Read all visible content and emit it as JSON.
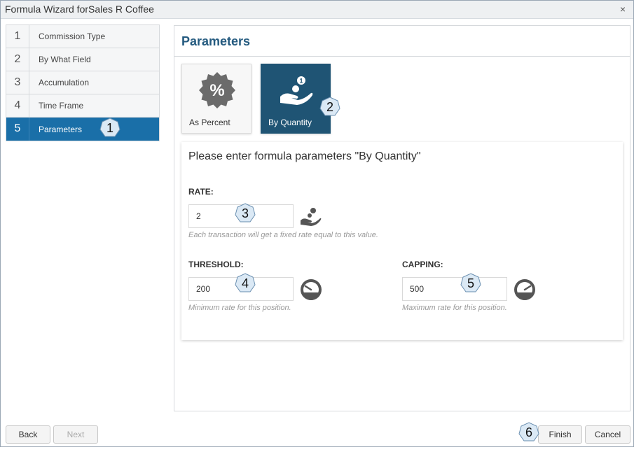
{
  "window": {
    "title": "Formula Wizard forSales R Coffee",
    "close_label": "×"
  },
  "steps": [
    {
      "num": "1",
      "label": "Commission Type"
    },
    {
      "num": "2",
      "label": "By What Field"
    },
    {
      "num": "3",
      "label": "Accumulation"
    },
    {
      "num": "4",
      "label": "Time Frame"
    },
    {
      "num": "5",
      "label": "Parameters"
    }
  ],
  "panel": {
    "title": "Parameters",
    "tiles": [
      {
        "label": "As Percent",
        "icon": "percent-badge-icon",
        "selected": false
      },
      {
        "label": "By Quantity",
        "icon": "hand-coins-icon",
        "selected": true
      }
    ]
  },
  "form": {
    "title": "Please enter formula parameters \"By Quantity\"",
    "rate": {
      "label": "RATE:",
      "value": "2",
      "hint": "Each transaction will get a fixed rate equal to this value."
    },
    "threshold": {
      "label": "THRESHOLD:",
      "value": "200",
      "hint": "Minimum rate for this position."
    },
    "capping": {
      "label": "CAPPING:",
      "value": "500",
      "hint": "Maximum rate for this position."
    }
  },
  "callouts": [
    "1",
    "2",
    "3",
    "4",
    "5",
    "6"
  ],
  "footer": {
    "back": "Back",
    "next": "Next",
    "finish": "Finish",
    "cancel": "Cancel"
  },
  "colors": {
    "accent": "#1a6fa8",
    "tile_selected": "#1f5474",
    "heading": "#245a7f",
    "badge_fill": "#dbe9f5"
  }
}
